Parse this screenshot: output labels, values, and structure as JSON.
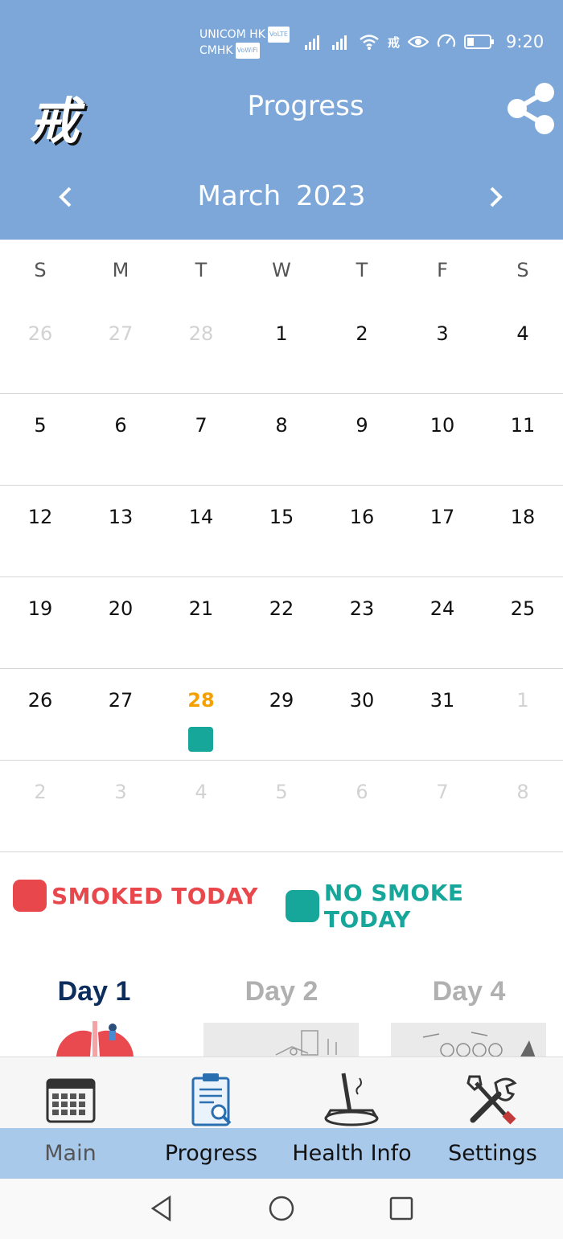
{
  "status_bar": {
    "carrier_1": "UNICOM HK",
    "carrier_1_tag": "VoLTE",
    "carrier_2": "CMHK",
    "carrier_2_tag": "VoWiFi",
    "notification_char": "戒",
    "time": "9:20"
  },
  "header": {
    "logo_text": "戒",
    "title": "Progress",
    "month": "March",
    "year": "2023",
    "prev_icon": "chevron-left-icon",
    "next_icon": "chevron-right-icon",
    "share_icon": "share-icon"
  },
  "calendar": {
    "weekdays": [
      "S",
      "M",
      "T",
      "W",
      "T",
      "F",
      "S"
    ],
    "weeks": [
      [
        {
          "d": "26",
          "out": true
        },
        {
          "d": "27",
          "out": true
        },
        {
          "d": "28",
          "out": true
        },
        {
          "d": "1"
        },
        {
          "d": "2"
        },
        {
          "d": "3"
        },
        {
          "d": "4"
        }
      ],
      [
        {
          "d": "5"
        },
        {
          "d": "6"
        },
        {
          "d": "7"
        },
        {
          "d": "8"
        },
        {
          "d": "9"
        },
        {
          "d": "10"
        },
        {
          "d": "11"
        }
      ],
      [
        {
          "d": "12"
        },
        {
          "d": "13"
        },
        {
          "d": "14"
        },
        {
          "d": "15"
        },
        {
          "d": "16"
        },
        {
          "d": "17"
        },
        {
          "d": "18"
        }
      ],
      [
        {
          "d": "19"
        },
        {
          "d": "20"
        },
        {
          "d": "21"
        },
        {
          "d": "22"
        },
        {
          "d": "23"
        },
        {
          "d": "24"
        },
        {
          "d": "25"
        }
      ],
      [
        {
          "d": "26"
        },
        {
          "d": "27"
        },
        {
          "d": "28",
          "today": true,
          "status": "no-smoke"
        },
        {
          "d": "29"
        },
        {
          "d": "30"
        },
        {
          "d": "31"
        },
        {
          "d": "1",
          "out": true
        }
      ],
      [
        {
          "d": "2",
          "out": true
        },
        {
          "d": "3",
          "out": true
        },
        {
          "d": "4",
          "out": true
        },
        {
          "d": "5",
          "out": true
        },
        {
          "d": "6",
          "out": true
        },
        {
          "d": "7",
          "out": true
        },
        {
          "d": "8",
          "out": true
        }
      ]
    ]
  },
  "legend": {
    "smoked_label": "SMOKED TODAY",
    "smoked_color": "#e8474c",
    "no_smoke_label": "NO SMOKE TODAY",
    "no_smoke_color": "#16a69a"
  },
  "milestones": [
    {
      "label": "Day 1",
      "active": true
    },
    {
      "label": "Day 2",
      "active": false
    },
    {
      "label": "Day 4",
      "active": false
    }
  ],
  "bottom_nav": {
    "items": [
      {
        "label": "Main",
        "icon": "calendar-icon",
        "active": true
      },
      {
        "label": "Progress",
        "icon": "clipboard-search-icon",
        "active": false
      },
      {
        "label": "Health Info",
        "icon": "ashtray-icon",
        "active": false
      },
      {
        "label": "Settings",
        "icon": "tools-icon",
        "active": false
      }
    ]
  },
  "colors": {
    "header_bg": "#7ca7d8",
    "today": "#f5a000",
    "nav_label_bg": "#a9c9ea",
    "milestone_active": "#0d2e5c",
    "milestone_inactive": "#b0b0b0"
  }
}
